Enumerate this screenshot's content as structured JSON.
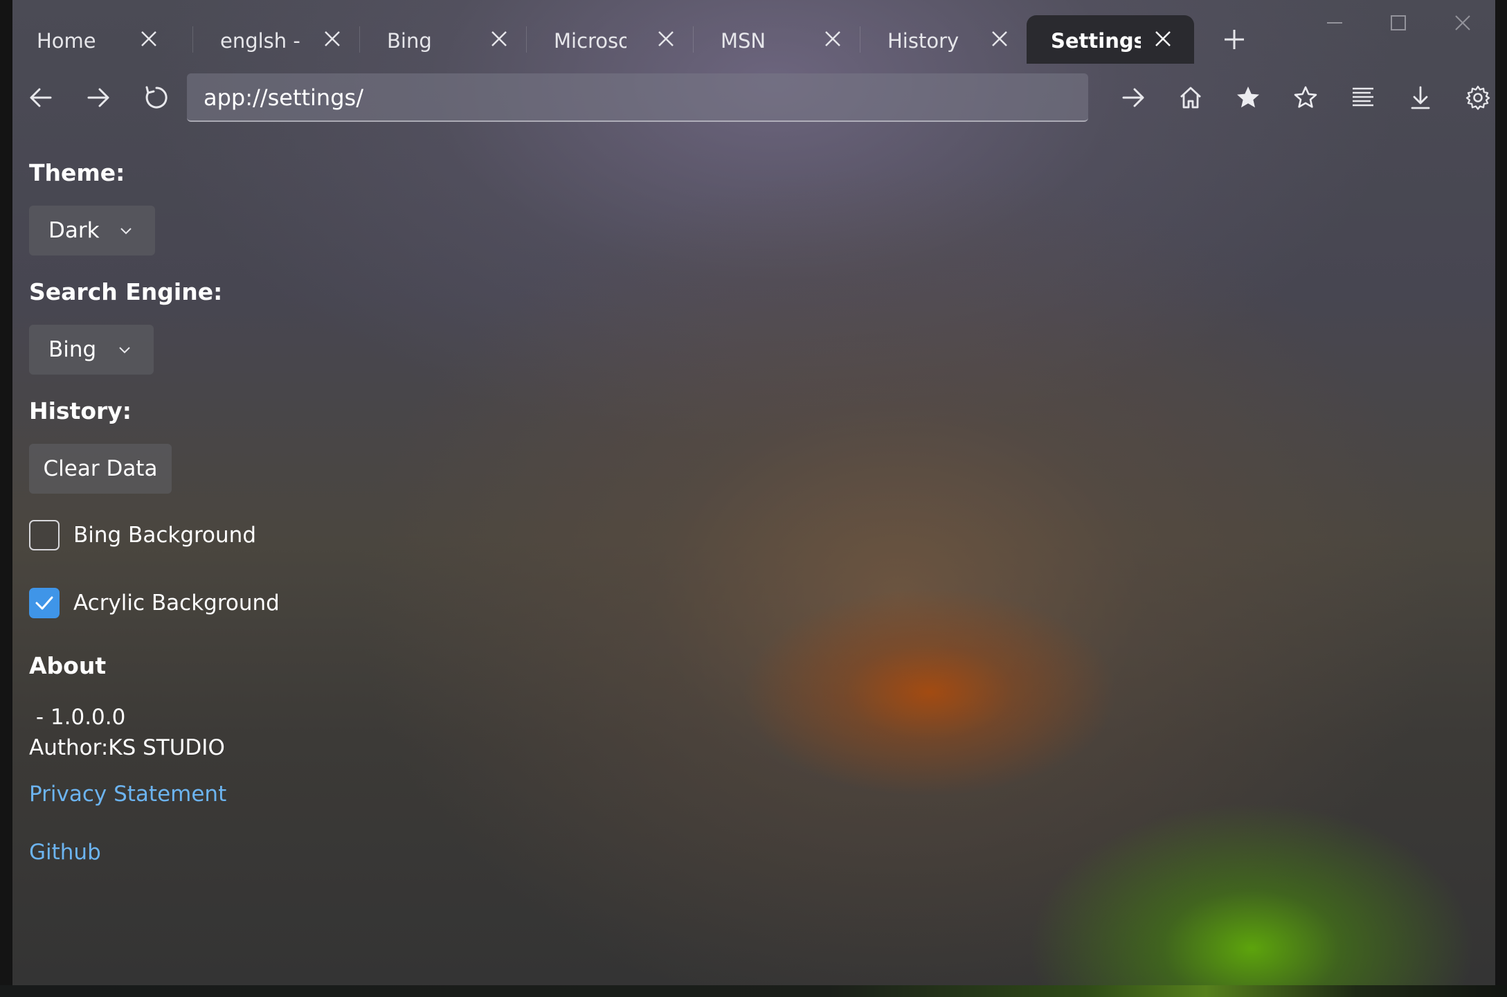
{
  "tabs": [
    {
      "title": "Home",
      "active": false
    },
    {
      "title": "englsh -",
      "active": false
    },
    {
      "title": "Bing",
      "active": false
    },
    {
      "title": "Microsof",
      "active": false
    },
    {
      "title": "MSN",
      "active": false
    },
    {
      "title": "History",
      "active": false
    },
    {
      "title": "Settings",
      "active": true
    }
  ],
  "address_bar": {
    "value": "app://settings/"
  },
  "icons": {
    "back": "arrow-left-icon",
    "forward": "arrow-right-icon",
    "refresh": "refresh-icon",
    "go": "go-arrow-icon",
    "home": "home-icon",
    "favorites": "star-filled-icon",
    "add_favorite": "star-outline-icon",
    "reading": "list-icon",
    "downloads": "download-icon",
    "settings": "gear-icon"
  },
  "settings": {
    "theme": {
      "label": "Theme:",
      "value": "Dark"
    },
    "search_engine": {
      "label": "Search Engine:",
      "value": "Bing"
    },
    "history": {
      "label": "History:",
      "clear_button": "Clear Data"
    },
    "bing_background": {
      "label": "Bing Background",
      "checked": false
    },
    "acrylic_background": {
      "label": "Acrylic Background",
      "checked": true
    },
    "about": {
      "label": "About",
      "version": " - 1.0.0.0",
      "author": "Author:KS STUDIO",
      "privacy_link": "Privacy Statement",
      "github_link": "Github"
    }
  },
  "colors": {
    "accent": "#3f95e8",
    "link": "#6cb4f0"
  }
}
